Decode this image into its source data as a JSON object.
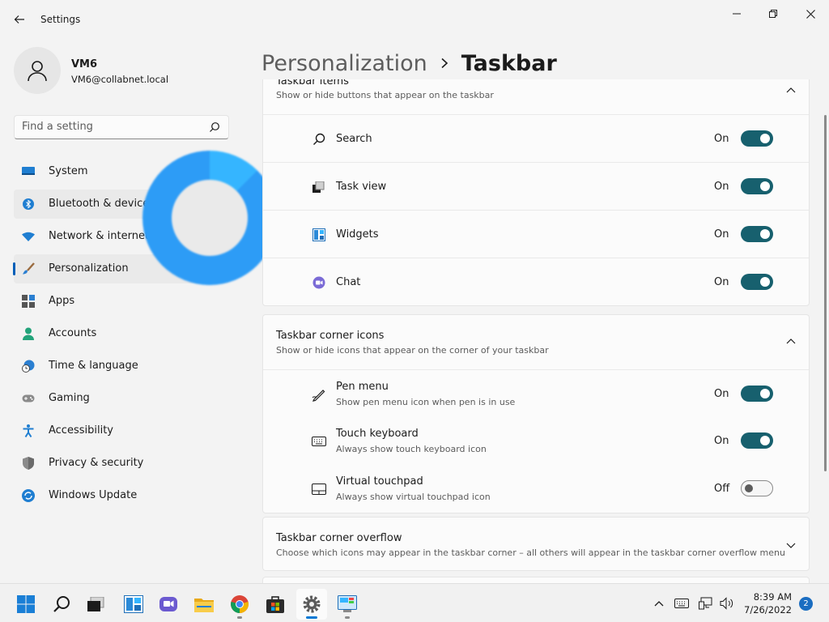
{
  "window": {
    "title": "Settings"
  },
  "profile": {
    "name": "VM6",
    "email": "VM6@collabnet.local"
  },
  "search": {
    "placeholder": "Find a setting"
  },
  "sidebar": {
    "items": [
      {
        "label": "System",
        "icon": "monitor-icon"
      },
      {
        "label": "Bluetooth & devices",
        "icon": "bluetooth-icon"
      },
      {
        "label": "Network & internet",
        "icon": "wifi-icon"
      },
      {
        "label": "Personalization",
        "icon": "brush-icon",
        "selected": true
      },
      {
        "label": "Apps",
        "icon": "apps-icon"
      },
      {
        "label": "Accounts",
        "icon": "person-icon"
      },
      {
        "label": "Time & language",
        "icon": "clock-globe-icon"
      },
      {
        "label": "Gaming",
        "icon": "gamepad-icon"
      },
      {
        "label": "Accessibility",
        "icon": "accessibility-icon"
      },
      {
        "label": "Privacy & security",
        "icon": "shield-icon"
      },
      {
        "label": "Windows Update",
        "icon": "update-icon"
      }
    ]
  },
  "breadcrumb": {
    "parent": "Personalization",
    "current": "Taskbar"
  },
  "sections": {
    "taskbar_items": {
      "title": "Taskbar items",
      "subtitle": "Show or hide buttons that appear on the taskbar",
      "rows": [
        {
          "label": "Search",
          "state": "On"
        },
        {
          "label": "Task view",
          "state": "On"
        },
        {
          "label": "Widgets",
          "state": "On"
        },
        {
          "label": "Chat",
          "state": "On"
        }
      ]
    },
    "corner_icons": {
      "title": "Taskbar corner icons",
      "subtitle": "Show or hide icons that appear on the corner of your taskbar",
      "rows": [
        {
          "label": "Pen menu",
          "desc": "Show pen menu icon when pen is in use",
          "state": "On"
        },
        {
          "label": "Touch keyboard",
          "desc": "Always show touch keyboard icon",
          "state": "On"
        },
        {
          "label": "Virtual touchpad",
          "desc": "Always show virtual touchpad icon",
          "state": "Off"
        }
      ]
    },
    "corner_overflow": {
      "title": "Taskbar corner overflow",
      "subtitle": "Choose which icons may appear in the taskbar corner – all others will appear in the taskbar corner overflow menu"
    }
  },
  "taskbar": {
    "clock": {
      "time": "8:39 AM",
      "date": "7/26/2022"
    },
    "notification_count": "2"
  },
  "colors": {
    "accent": "#005fb8",
    "toggle_on": "#17606e"
  }
}
